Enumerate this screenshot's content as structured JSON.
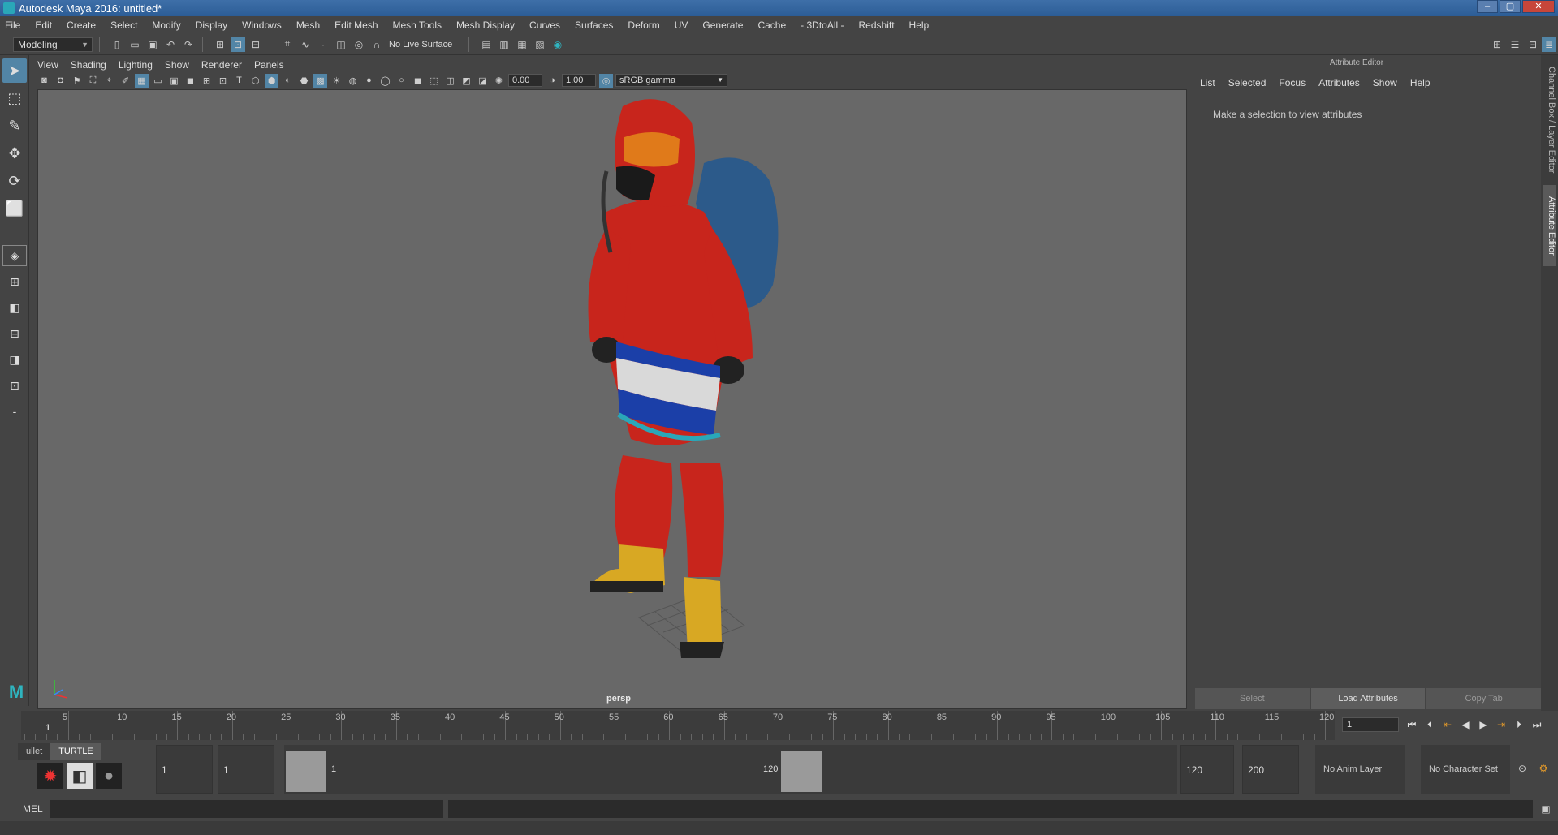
{
  "window": {
    "title": "Autodesk Maya 2016: untitled*",
    "minimize": "–",
    "maximize": "▢",
    "close": "✕"
  },
  "menu": [
    "File",
    "Edit",
    "Create",
    "Select",
    "Modify",
    "Display",
    "Windows",
    "Mesh",
    "Edit Mesh",
    "Mesh Tools",
    "Mesh Display",
    "Curves",
    "Surfaces",
    "Deform",
    "UV",
    "Generate",
    "Cache",
    "- 3DtoAll -",
    "Redshift",
    "Help"
  ],
  "toolbar": {
    "mode": "Modeling",
    "live_surface": "No Live Surface"
  },
  "panel_menu": [
    "View",
    "Shading",
    "Lighting",
    "Show",
    "Renderer",
    "Panels"
  ],
  "panel_tools": {
    "exposure": "0.00",
    "gamma": "1.00",
    "color_space": "sRGB gamma"
  },
  "viewport": {
    "camera_label": "persp"
  },
  "attribute_editor": {
    "title": "Attribute Editor",
    "menu": [
      "List",
      "Selected",
      "Focus",
      "Attributes",
      "Show",
      "Help"
    ],
    "message": "Make a selection to view attributes",
    "buttons": {
      "select": "Select",
      "load": "Load Attributes",
      "copy": "Copy Tab"
    }
  },
  "side_tabs": {
    "channel_box": "Channel Box / Layer Editor",
    "attribute_editor": "Attribute Editor"
  },
  "timeline": {
    "ticks": [
      "5",
      "10",
      "15",
      "20",
      "25",
      "30",
      "35",
      "40",
      "45",
      "50",
      "55",
      "60",
      "65",
      "70",
      "75",
      "80",
      "85",
      "90",
      "95",
      "100",
      "105",
      "110",
      "115",
      "120"
    ],
    "current_frame": "1",
    "frame_field": "1"
  },
  "shelf": {
    "tabs": [
      "ullet",
      "TURTLE"
    ]
  },
  "range": {
    "start": "1",
    "playback_start": "1",
    "slider_start": "1",
    "slider_end": "120",
    "playback_end": "120",
    "end": "200",
    "anim_layer": "No Anim Layer",
    "character_set": "No Character Set"
  },
  "command": {
    "label": "MEL"
  },
  "colors": {
    "accent": "#5285a6",
    "maya_teal": "#2fb4bf",
    "suit_red": "#c8251c",
    "flag_blue": "#1b3fa8"
  }
}
